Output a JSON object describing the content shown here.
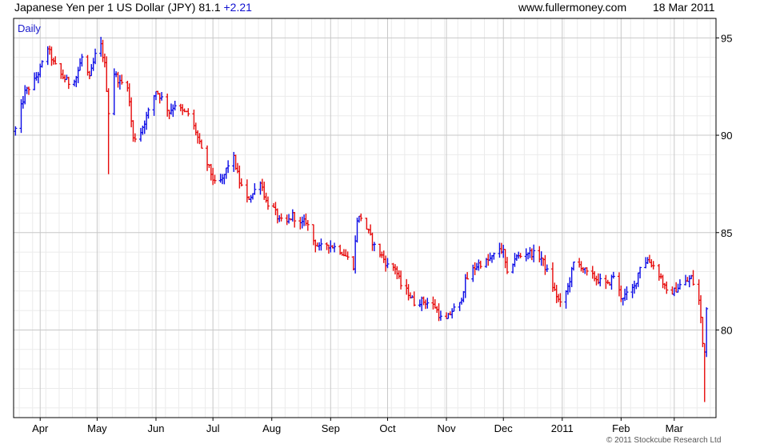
{
  "header": {
    "left": "Japanese Yen per 1 US Dollar (JPY) 81.1",
    "change": "+2.21",
    "site": "www.fullermoney.com",
    "date": "18 Mar 2011"
  },
  "credit": "© 2011 Stockcube Research Ltd",
  "colors": {
    "up": "#0a0ae6",
    "down": "#e60a0a",
    "grid_major": "#c8c8c8",
    "grid_minor": "#ebebeb",
    "period_label": "#1a1acc"
  },
  "chart_data": {
    "type": "bar",
    "title": "Japanese Yen per 1 US Dollar (JPY)",
    "period_label": "Daily",
    "last": 81.1,
    "change": 2.21,
    "y_axis_side": "right",
    "ylim": [
      75.5,
      96
    ],
    "y_ticks": [
      {
        "value": 95,
        "label": "95"
      },
      {
        "value": 90,
        "label": "90"
      },
      {
        "value": 85,
        "label": "85"
      },
      {
        "value": 80,
        "label": "80"
      }
    ],
    "x_ticks": [
      {
        "date": "2010-04-01",
        "label": "Apr"
      },
      {
        "date": "2010-05-01",
        "label": "May"
      },
      {
        "date": "2010-06-01",
        "label": "Jun"
      },
      {
        "date": "2010-07-01",
        "label": "Jul"
      },
      {
        "date": "2010-08-01",
        "label": "Aug"
      },
      {
        "date": "2010-09-01",
        "label": "Sep"
      },
      {
        "date": "2010-10-01",
        "label": "Oct"
      },
      {
        "date": "2010-11-01",
        "label": "Nov"
      },
      {
        "date": "2010-12-01",
        "label": "Dec"
      },
      {
        "date": "2011-01-01",
        "label": "2011"
      },
      {
        "date": "2011-02-01",
        "label": "Feb"
      },
      {
        "date": "2011-03-01",
        "label": "Mar"
      }
    ],
    "xlim": [
      "2010-03-18",
      "2011-03-23"
    ],
    "grid": true,
    "closes": [
      [
        "2010-03-19",
        90.3
      ],
      [
        "2010-03-24",
        92.2
      ],
      [
        "2010-03-29",
        92.8
      ],
      [
        "2010-04-01",
        93.4
      ],
      [
        "2010-04-05",
        94.5
      ],
      [
        "2010-04-08",
        93.7
      ],
      [
        "2010-04-12",
        93.1
      ],
      [
        "2010-04-16",
        92.7
      ],
      [
        "2010-04-20",
        93.0
      ],
      [
        "2010-04-23",
        94.0
      ],
      [
        "2010-04-27",
        92.9
      ],
      [
        "2010-04-30",
        94.1
      ],
      [
        "2010-05-03",
        94.6
      ],
      [
        "2010-05-05",
        93.6
      ],
      [
        "2010-05-07",
        91.2
      ],
      [
        "2010-05-10",
        93.2
      ],
      [
        "2010-05-13",
        92.7
      ],
      [
        "2010-05-17",
        92.6
      ],
      [
        "2010-05-20",
        89.8
      ],
      [
        "2010-05-24",
        90.2
      ],
      [
        "2010-05-28",
        91.2
      ],
      [
        "2010-06-01",
        92.3
      ],
      [
        "2010-06-04",
        91.9
      ],
      [
        "2010-06-08",
        91.2
      ],
      [
        "2010-06-11",
        91.6
      ],
      [
        "2010-06-15",
        91.2
      ],
      [
        "2010-06-18",
        91.1
      ],
      [
        "2010-06-22",
        90.2
      ],
      [
        "2010-06-25",
        89.2
      ],
      [
        "2010-06-29",
        88.3
      ],
      [
        "2010-07-02",
        87.5
      ],
      [
        "2010-07-06",
        87.7
      ],
      [
        "2010-07-09",
        88.5
      ],
      [
        "2010-07-12",
        88.8
      ],
      [
        "2010-07-15",
        87.6
      ],
      [
        "2010-07-19",
        86.7
      ],
      [
        "2010-07-22",
        87.0
      ],
      [
        "2010-07-26",
        87.7
      ],
      [
        "2010-07-29",
        86.6
      ],
      [
        "2010-08-02",
        86.2
      ],
      [
        "2010-08-05",
        85.6
      ],
      [
        "2010-08-09",
        85.5
      ],
      [
        "2010-08-12",
        85.9
      ],
      [
        "2010-08-16",
        85.4
      ],
      [
        "2010-08-19",
        85.6
      ],
      [
        "2010-08-23",
        84.6
      ],
      [
        "2010-08-26",
        84.2
      ],
      [
        "2010-08-30",
        84.4
      ],
      [
        "2010-09-02",
        84.3
      ],
      [
        "2010-09-06",
        84.1
      ],
      [
        "2010-09-09",
        83.8
      ],
      [
        "2010-09-13",
        83.3
      ],
      [
        "2010-09-15",
        85.7
      ],
      [
        "2010-09-17",
        85.8
      ],
      [
        "2010-09-21",
        85.0
      ],
      [
        "2010-09-24",
        84.3
      ],
      [
        "2010-09-28",
        83.8
      ],
      [
        "2010-10-01",
        83.3
      ],
      [
        "2010-10-05",
        83.2
      ],
      [
        "2010-10-08",
        82.3
      ],
      [
        "2010-10-12",
        81.9
      ],
      [
        "2010-10-15",
        81.4
      ],
      [
        "2010-10-19",
        81.5
      ],
      [
        "2010-10-22",
        81.4
      ],
      [
        "2010-10-26",
        81.2
      ],
      [
        "2010-10-29",
        80.6
      ],
      [
        "2010-11-01",
        80.5
      ],
      [
        "2010-11-04",
        81.0
      ],
      [
        "2010-11-08",
        81.3
      ],
      [
        "2010-11-11",
        82.5
      ],
      [
        "2010-11-15",
        83.1
      ],
      [
        "2010-11-18",
        83.4
      ],
      [
        "2010-11-22",
        83.5
      ],
      [
        "2010-11-25",
        83.7
      ],
      [
        "2010-11-29",
        84.2
      ],
      [
        "2010-12-01",
        84.0
      ],
      [
        "2010-12-03",
        82.8
      ],
      [
        "2010-12-07",
        83.7
      ],
      [
        "2010-12-10",
        83.8
      ],
      [
        "2010-12-14",
        84.0
      ],
      [
        "2010-12-17",
        83.9
      ],
      [
        "2010-12-21",
        83.7
      ],
      [
        "2010-12-24",
        83.0
      ],
      [
        "2010-12-28",
        82.0
      ],
      [
        "2010-12-31",
        81.3
      ],
      [
        "2011-01-04",
        82.2
      ],
      [
        "2011-01-07",
        83.4
      ],
      [
        "2011-01-11",
        83.3
      ],
      [
        "2011-01-14",
        82.9
      ],
      [
        "2011-01-18",
        82.7
      ],
      [
        "2011-01-21",
        82.5
      ],
      [
        "2011-01-25",
        82.3
      ],
      [
        "2011-01-28",
        82.8
      ],
      [
        "2011-02-01",
        81.7
      ],
      [
        "2011-02-04",
        81.8
      ],
      [
        "2011-02-08",
        82.2
      ],
      [
        "2011-02-11",
        83.3
      ],
      [
        "2011-02-15",
        83.6
      ],
      [
        "2011-02-18",
        83.3
      ],
      [
        "2011-02-22",
        82.7
      ],
      [
        "2011-02-25",
        81.9
      ],
      [
        "2011-03-01",
        82.0
      ],
      [
        "2011-03-04",
        82.3
      ],
      [
        "2011-03-08",
        82.5
      ],
      [
        "2011-03-10",
        82.7
      ],
      [
        "2011-03-14",
        81.5
      ],
      [
        "2011-03-15",
        80.6
      ],
      [
        "2011-03-16",
        79.3
      ],
      [
        "2011-03-17",
        79.0
      ],
      [
        "2011-03-18",
        81.1
      ]
    ],
    "spikes": [
      {
        "date": "2010-05-07",
        "low": 88.0
      },
      {
        "date": "2011-03-17",
        "low": 76.3
      }
    ]
  }
}
